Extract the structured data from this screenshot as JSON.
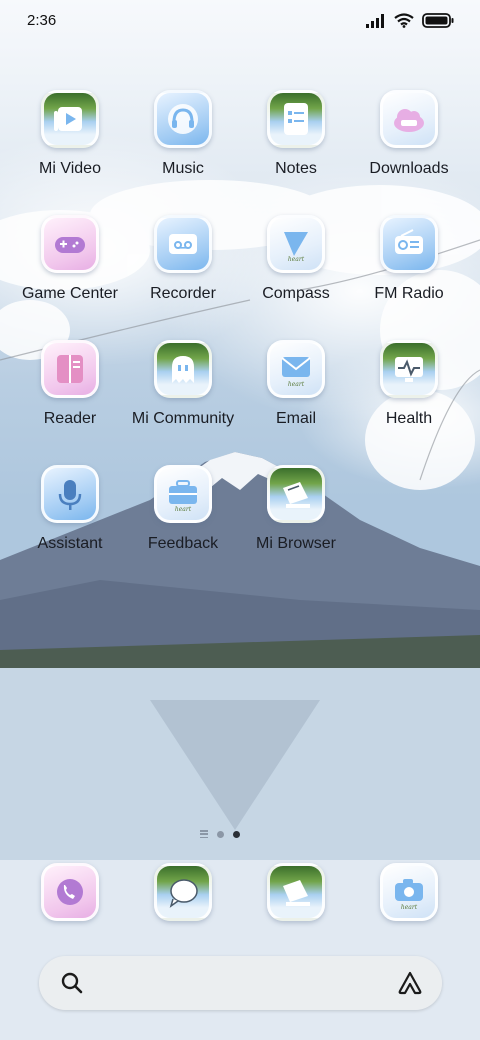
{
  "status_bar": {
    "time": "2:36"
  },
  "apps": [
    {
      "label": "Mi Video"
    },
    {
      "label": "Music"
    },
    {
      "label": "Notes"
    },
    {
      "label": "Downloads"
    },
    {
      "label": "Game Center"
    },
    {
      "label": "Recorder"
    },
    {
      "label": "Compass"
    },
    {
      "label": "FM Radio"
    },
    {
      "label": "Reader"
    },
    {
      "label": "Mi Community"
    },
    {
      "label": "Email"
    },
    {
      "label": "Health"
    },
    {
      "label": "Assistant"
    },
    {
      "label": "Feedback"
    },
    {
      "label": "Mi Browser"
    }
  ],
  "icon_badge_text": "heart",
  "dock": [
    {
      "icon": "phone-icon"
    },
    {
      "icon": "messaging-icon"
    },
    {
      "icon": "browser-icon"
    },
    {
      "icon": "camera-icon"
    }
  ],
  "pager": {
    "pages": 2,
    "active": 2
  },
  "colors": {
    "accent_blue": "#9fcaf3",
    "accent_pink": "#f1c6ec",
    "label": "#1a1d24"
  }
}
